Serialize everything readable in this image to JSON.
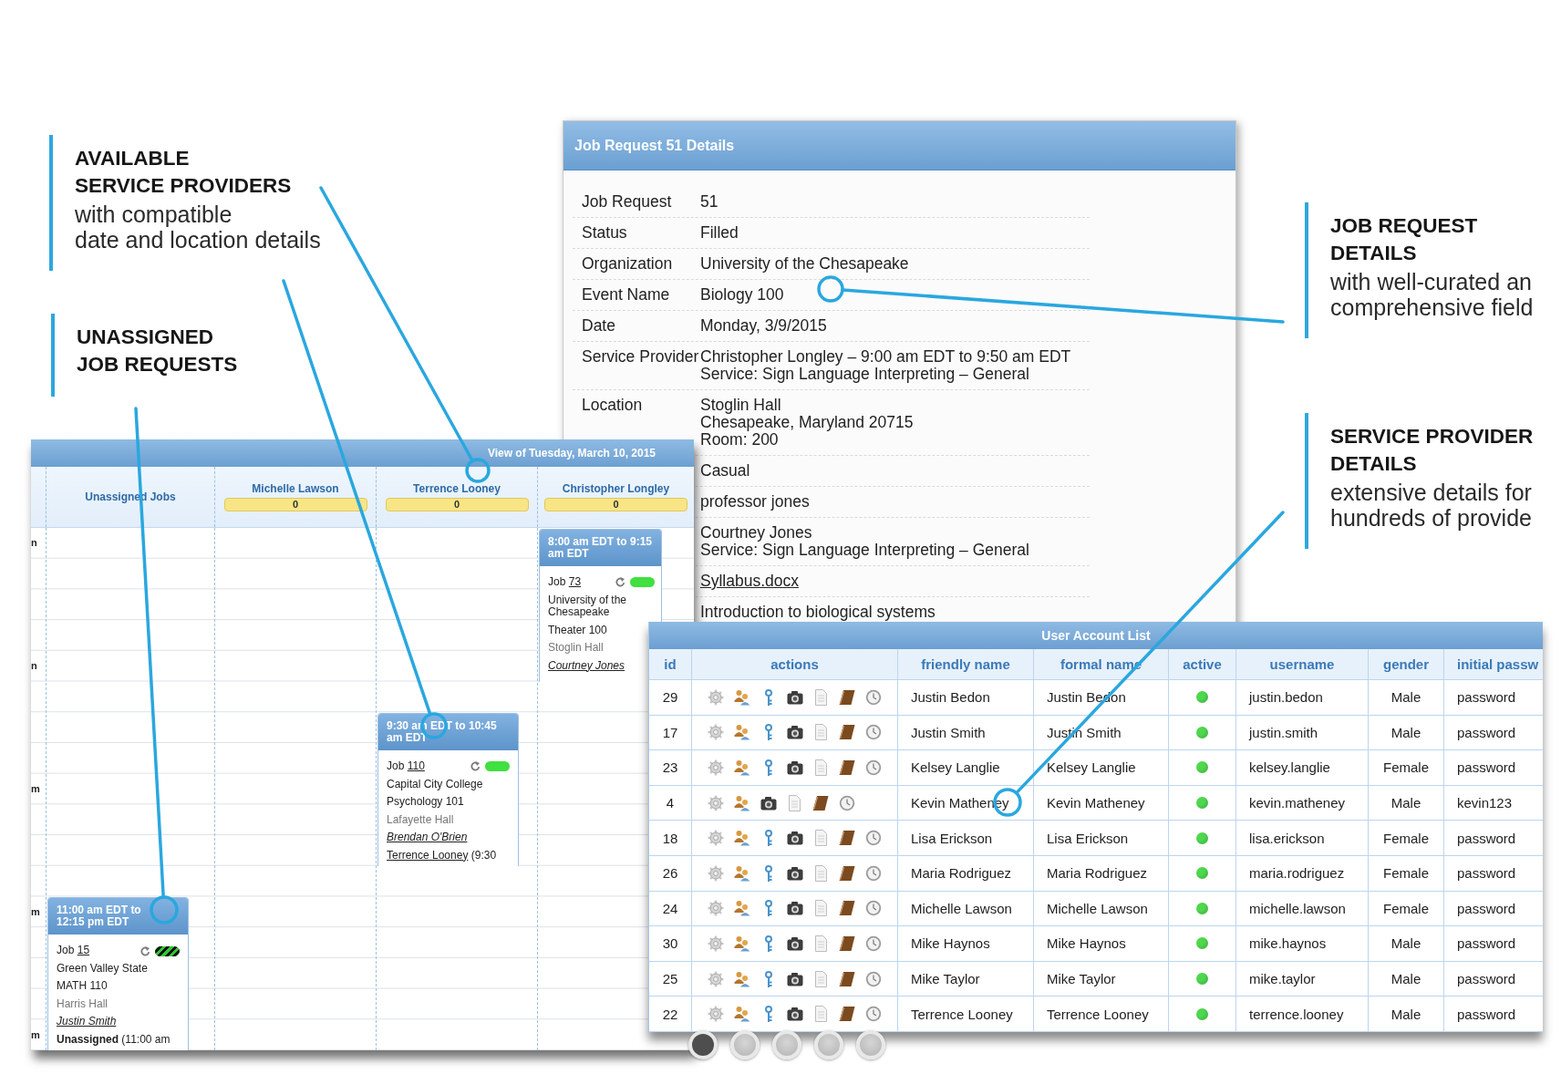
{
  "callouts": [
    {
      "title": [
        "AVAILABLE",
        "SERVICE PROVIDERS"
      ],
      "text": [
        "with compatible",
        "date and location details"
      ]
    },
    {
      "title": [
        "UNASSIGNED",
        "JOB REQUESTS"
      ]
    },
    {
      "title": [
        "JOB REQUEST",
        "DETAILS"
      ],
      "text": [
        "with well-curated an",
        "comprehensive field"
      ]
    },
    {
      "title": [
        "SERVICE PROVIDER",
        "DETAILS"
      ],
      "text": [
        "extensive details for",
        "hundreds of provide"
      ]
    }
  ],
  "job_details": {
    "title": "Job Request 51 Details",
    "rows": [
      {
        "kind": "text",
        "label": "Job Request",
        "value": [
          "51"
        ]
      },
      {
        "kind": "text",
        "label": "Status",
        "value": [
          "Filled"
        ]
      },
      {
        "kind": "text",
        "label": "Organization",
        "value": [
          "University of the Chesapeake"
        ]
      },
      {
        "kind": "text",
        "label": "Event Name",
        "value": [
          "Biology 100"
        ]
      },
      {
        "kind": "text",
        "label": "Date",
        "value": [
          "Monday, 3/9/2015"
        ]
      },
      {
        "kind": "text",
        "label": "Service Provider",
        "value": [
          "Christopher Longley – 9:00 am EDT to 9:50 am EDT",
          "Service: Sign Language Interpreting – General"
        ]
      },
      {
        "kind": "text",
        "label": "Location",
        "value": [
          "Stoglin Hall",
          "Chesapeake, Maryland 20715",
          "Room: 200"
        ]
      },
      {
        "kind": "text",
        "value": [
          "Casual"
        ]
      },
      {
        "kind": "text",
        "value": [
          "professor jones"
        ]
      },
      {
        "kind": "text",
        "value": [
          "Courtney Jones",
          "Service: Sign Language Interpreting – General"
        ]
      },
      {
        "kind": "link",
        "value": [
          "Syllabus.docx"
        ]
      },
      {
        "kind": "text",
        "value": [
          "Introduction to biological systems"
        ]
      }
    ]
  },
  "calendar": {
    "title": "View of Tuesday, March 10, 2015",
    "time_labels": [
      "n",
      "n",
      "m",
      "m",
      "m"
    ],
    "columns": [
      {
        "name": "Unassigned Jobs",
        "events": [
          {
            "time": "11:00 am EDT to 12:15 pm EDT",
            "job": "Job",
            "job_number": "15",
            "striped": true,
            "lines": [
              {
                "kind": "org",
                "text": "Green Valley State"
              },
              {
                "kind": "event",
                "text": "MATH 110"
              },
              {
                "kind": "location",
                "text": "Harris Hall"
              },
              {
                "kind": "contact",
                "text": "Justin Smith"
              },
              {
                "kind": "unassigned",
                "text": "Unassigned",
                "note": "(11:00 am"
              }
            ]
          }
        ]
      },
      {
        "name": "Michelle Lawson",
        "count": "0"
      },
      {
        "name": "Terrence Looney",
        "count": "0",
        "events": [
          {
            "time": "9:30 am EDT to 10:45 am EDT",
            "job": "Job",
            "job_number": "110",
            "striped": false,
            "lines": [
              {
                "kind": "org",
                "text": "Capital City College"
              },
              {
                "kind": "event",
                "text": "Psychology 101"
              },
              {
                "kind": "location",
                "text": "Lafayette Hall"
              },
              {
                "kind": "contact",
                "text": "Brendan O'Brien"
              },
              {
                "kind": "assigned",
                "text": "Terrence Looney",
                "note": "(9:30"
              }
            ]
          }
        ]
      },
      {
        "name": "Christopher Longley",
        "count": "0",
        "events": [
          {
            "time": "8:00 am EDT to 9:15 am EDT",
            "job": "Job",
            "job_number": "73",
            "striped": false,
            "lines": [
              {
                "kind": "org",
                "text": "University of the Chesapeake"
              },
              {
                "kind": "event",
                "text": "Theater 100"
              },
              {
                "kind": "location",
                "text": "Stoglin Hall"
              },
              {
                "kind": "contact",
                "text": "Courtney Jones"
              }
            ]
          }
        ]
      }
    ]
  },
  "user_list": {
    "title": "User Account List",
    "columns": [
      "id",
      "actions",
      "friendly name",
      "formal name",
      "active",
      "username",
      "gender",
      "initial passw"
    ],
    "rows": [
      {
        "id": "29",
        "key_action": true,
        "friendly_name": "Justin Bedon",
        "formal_name": "Justin Bedon",
        "active": true,
        "username": "justin.bedon",
        "gender": "Male",
        "initial_password": "password"
      },
      {
        "id": "17",
        "key_action": true,
        "friendly_name": "Justin Smith",
        "formal_name": "Justin Smith",
        "active": true,
        "username": "justin.smith",
        "gender": "Male",
        "initial_password": "password"
      },
      {
        "id": "23",
        "key_action": true,
        "friendly_name": "Kelsey Langlie",
        "formal_name": "Kelsey Langlie",
        "active": true,
        "username": "kelsey.langlie",
        "gender": "Female",
        "initial_password": "password"
      },
      {
        "id": "4",
        "key_action": false,
        "friendly_name": "Kevin Matheney",
        "formal_name": "Kevin Matheney",
        "active": true,
        "username": "kevin.matheney",
        "gender": "Male",
        "initial_password": "kevin123"
      },
      {
        "id": "18",
        "key_action": true,
        "friendly_name": "Lisa Erickson",
        "formal_name": "Lisa Erickson",
        "active": true,
        "username": "lisa.erickson",
        "gender": "Female",
        "initial_password": "password"
      },
      {
        "id": "26",
        "key_action": true,
        "friendly_name": "Maria Rodriguez",
        "formal_name": "Maria Rodriguez",
        "active": true,
        "username": "maria.rodriguez",
        "gender": "Female",
        "initial_password": "password"
      },
      {
        "id": "24",
        "key_action": true,
        "friendly_name": "Michelle Lawson",
        "formal_name": "Michelle Lawson",
        "active": true,
        "username": "michelle.lawson",
        "gender": "Female",
        "initial_password": "password"
      },
      {
        "id": "30",
        "key_action": true,
        "friendly_name": "Mike Haynos",
        "formal_name": "Mike Haynos",
        "active": true,
        "username": "mike.haynos",
        "gender": "Male",
        "initial_password": "password"
      },
      {
        "id": "25",
        "key_action": true,
        "friendly_name": "Mike Taylor",
        "formal_name": "Mike Taylor",
        "active": true,
        "username": "mike.taylor",
        "gender": "Male",
        "initial_password": "password"
      },
      {
        "id": "22",
        "key_action": true,
        "friendly_name": "Terrence Looney",
        "formal_name": "Terrence Looney",
        "active": true,
        "username": "terrence.looney",
        "gender": "Male",
        "initial_password": "password"
      }
    ]
  },
  "pagination": [
    {
      "selected": true
    },
    {
      "selected": false
    },
    {
      "selected": false
    },
    {
      "selected": false
    },
    {
      "selected": false
    }
  ]
}
